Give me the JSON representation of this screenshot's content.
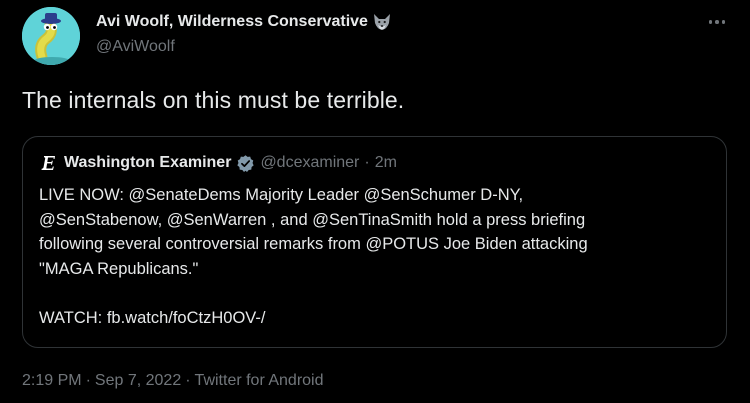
{
  "author": {
    "display_name": "Avi Woolf, Wilderness Conservative",
    "emoji_icon": "wolf-face-icon",
    "handle": "@AviWoolf"
  },
  "tweet": {
    "text": "The internals on this must be terrible."
  },
  "quoted_tweet": {
    "author_name": "Washington Examiner",
    "verified": true,
    "handle": "@dcexaminer",
    "separator": "·",
    "time": "2m",
    "lines": [
      "LIVE NOW: @SenateDems Majority Leader @SenSchumer D-NY,",
      "@SenStabenow, @SenWarren , and @SenTinaSmith hold a press briefing",
      "following several controversial remarks from @POTUS Joe Biden attacking",
      "\"MAGA Republicans.\""
    ],
    "watch_line": "WATCH: fb.watch/foCtzH0OV-/"
  },
  "meta": {
    "time": "2:19 PM",
    "sep1": "·",
    "date": "Sep 7, 2022",
    "sep2": "·",
    "source": "Twitter for Android"
  },
  "colors": {
    "background": "#000000",
    "text_primary": "#e7e9ea",
    "text_secondary": "#71767b",
    "border": "#2f3336",
    "verified_badge": "#829aab",
    "avatar_bg": "#5fd3d8"
  }
}
